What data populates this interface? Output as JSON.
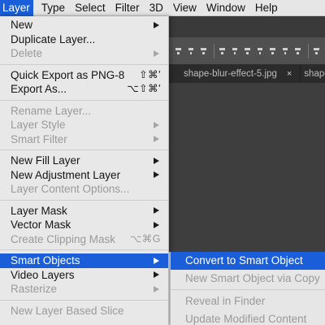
{
  "menubar": {
    "items": [
      "Layer",
      "Type",
      "Select",
      "Filter",
      "3D",
      "View",
      "Window",
      "Help"
    ],
    "active": "Layer"
  },
  "document_tabs": [
    {
      "label": "shape-blur-effect-5.jpg",
      "close": "×"
    },
    {
      "label": "shape-F"
    }
  ],
  "layer_menu": {
    "items": [
      {
        "label": "New",
        "arrow": true,
        "disabled": false
      },
      {
        "label": "Duplicate Layer...",
        "disabled": false
      },
      {
        "label": "Delete",
        "arrow": true,
        "disabled": true
      },
      {
        "label": "Quick Export as PNG-8",
        "shortcut": "⇧⌘'",
        "disabled": false
      },
      {
        "label": "Export As...",
        "shortcut": "⌥⇧⌘'",
        "disabled": false
      },
      {
        "label": "Rename Layer...",
        "disabled": true
      },
      {
        "label": "Layer Style",
        "arrow": true,
        "disabled": true
      },
      {
        "label": "Smart Filter",
        "arrow": true,
        "disabled": true
      },
      {
        "label": "New Fill Layer",
        "arrow": true,
        "disabled": false
      },
      {
        "label": "New Adjustment Layer",
        "arrow": true,
        "disabled": false
      },
      {
        "label": "Layer Content Options...",
        "disabled": true
      },
      {
        "label": "Layer Mask",
        "arrow": true,
        "disabled": false
      },
      {
        "label": "Vector Mask",
        "arrow": true,
        "disabled": false
      },
      {
        "label": "Create Clipping Mask",
        "shortcut": "⌥⌘G",
        "disabled": true
      },
      {
        "label": "Smart Objects",
        "arrow": true,
        "selected": true
      },
      {
        "label": "Video Layers",
        "arrow": true,
        "disabled": false
      },
      {
        "label": "Rasterize",
        "arrow": true,
        "disabled": true
      },
      {
        "label": "New Layer Based Slice",
        "disabled": true
      }
    ]
  },
  "smart_objects_submenu": {
    "items": [
      {
        "label": "Convert to Smart Object",
        "selected": true
      },
      {
        "label": "New Smart Object via Copy",
        "disabled": true
      },
      {
        "label": "Reveal in Finder",
        "disabled": true
      },
      {
        "label": "Update Modified Content",
        "disabled": true
      }
    ]
  },
  "colors": {
    "selection": "#1a5fd9",
    "menu_background": "#e8e8e8",
    "disabled_text": "#9a9a9a",
    "app_background": "#3a3a3a"
  }
}
